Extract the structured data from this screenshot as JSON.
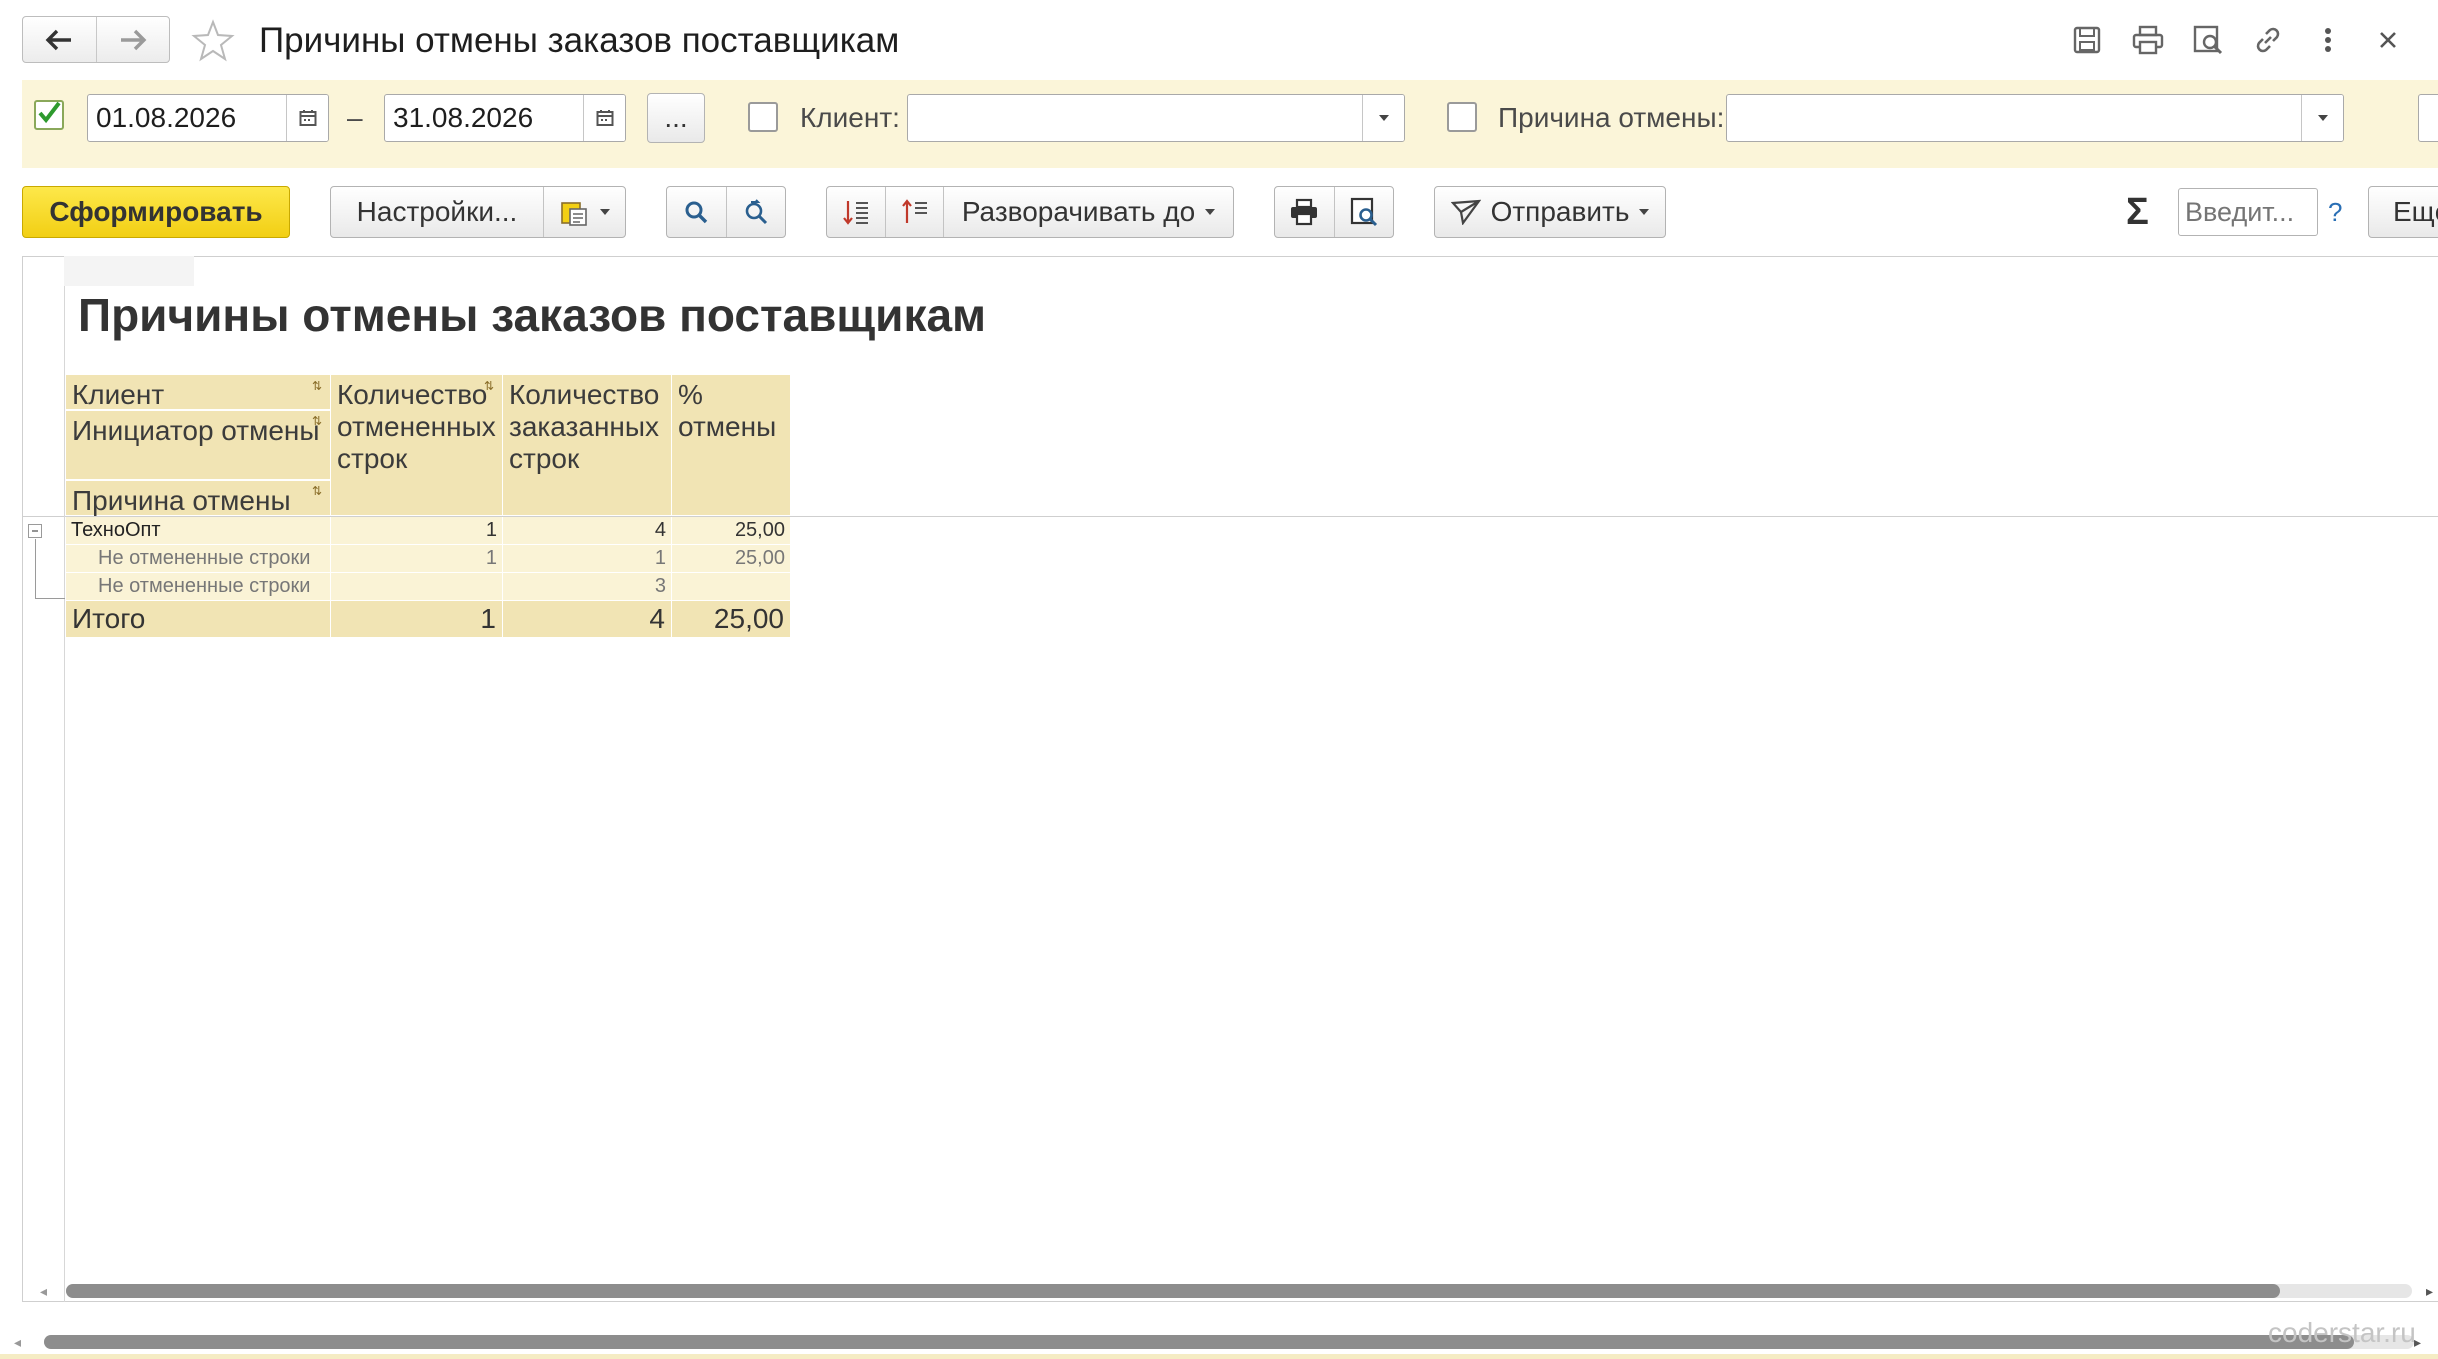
{
  "window": {
    "title": "Причины отмены заказов поставщикам",
    "icons": [
      "back-arrow-icon",
      "forward-arrow-icon",
      "star-icon",
      "save-icon",
      "print-icon",
      "preview-icon",
      "link-icon",
      "more-icon",
      "close-icon"
    ]
  },
  "filters": {
    "date_from": "01.08.2026",
    "date_to": "31.08.2026",
    "dash": "–",
    "period_button": "...",
    "client_label": "Клиент:",
    "client_value": "",
    "reason_label": "Причина отмены:",
    "reason_value": ""
  },
  "toolbar": {
    "generate": "Сформировать",
    "settings": "Настройки...",
    "expand_to": "Разворачивать до",
    "send": "Отправить",
    "sum_symbol": "Σ",
    "input_placeholder": "Введит...",
    "help": "?",
    "more": "Ещё"
  },
  "report": {
    "title": "Причины отмены заказов поставщикам",
    "headers": {
      "col1": [
        "Клиент",
        "Инициатор отмены",
        "Причина отмены"
      ],
      "col2": "Количество отмененных строк",
      "col3": "Количество заказанных строк",
      "col4": "% отмены"
    },
    "rows": [
      {
        "label": "ТехноОпт",
        "cancelled": "1",
        "ordered": "4",
        "percent": "25,00"
      },
      {
        "label": "Не отмененные строки",
        "cancelled": "1",
        "ordered": "1",
        "percent": "25,00"
      },
      {
        "label": "Не отмененные строки",
        "cancelled": "",
        "ordered": "3",
        "percent": ""
      }
    ],
    "total": {
      "label": "Итого",
      "cancelled": "1",
      "ordered": "4",
      "percent": "25,00"
    }
  },
  "watermark": "coderstar.ru"
}
